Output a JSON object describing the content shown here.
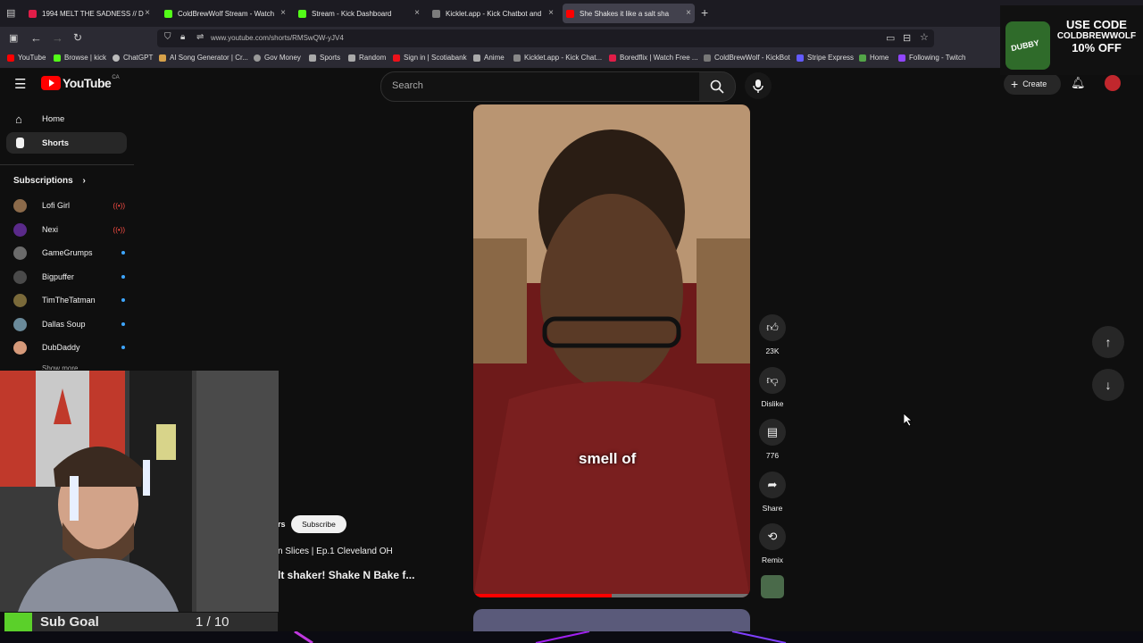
{
  "browser": {
    "tabs": [
      {
        "label": "1994 MELT THE SADNESS // D",
        "color": "#e11d48"
      },
      {
        "label": "ColdBrewWolf Stream - Watch",
        "color": "#53fc18"
      },
      {
        "label": "Stream - Kick Dashboard",
        "color": "#53fc18"
      },
      {
        "label": "Kicklet.app - Kick Chatbot and",
        "color": "#7c7c7c"
      },
      {
        "label": "She Shakes it like a salt sha",
        "color": "#ff0000"
      }
    ],
    "url": "www.youtube.com/shorts/RMSwQW-yJV4",
    "bookmarks": [
      "YouTube",
      "Browse | kick",
      "ChatGPT",
      "AI Song Generator | Cr...",
      "Gov Money",
      "Sports",
      "Random",
      "Sign in | Scotiabank",
      "Anime",
      "Kicklet.app - Kick Chat...",
      "Boredflix | Watch Free ...",
      "ColdBrewWolf - KickBot",
      "Stripe Express",
      "Home",
      "Following - Twitch"
    ]
  },
  "youtube": {
    "logo": "YouTube",
    "region": "CA",
    "search_placeholder": "Search",
    "create_label": "Create",
    "nav": [
      {
        "label": "Home",
        "icon": "home-icon"
      },
      {
        "label": "Shorts",
        "icon": "shorts-icon"
      }
    ],
    "subscriptions_title": "Subscriptions",
    "subscriptions": [
      {
        "name": "Lofi Girl",
        "color": "#8b6a4a",
        "live": true
      },
      {
        "name": "Nexi",
        "color": "#5a2a8a",
        "live": true
      },
      {
        "name": "GameGrumps",
        "color": "#6b6b6b",
        "live": false
      },
      {
        "name": "Bigpuffer",
        "color": "#4a4a4a",
        "live": false
      },
      {
        "name": "TimTheTatman",
        "color": "#7a6a3a",
        "live": false
      },
      {
        "name": "Dallas Soup",
        "color": "#6a8a9a",
        "live": false
      },
      {
        "name": "DubDaddy",
        "color": "#d69a7a",
        "live": false
      }
    ],
    "show_more": "Show more",
    "short": {
      "caption": "smell of",
      "channel_suffix": "rs",
      "subscribe": "Subscribe",
      "series": "n Slices | Ep.1 Cleveland OH",
      "title": "lt shaker! Shake N Bake f...",
      "progress_pct": 50
    },
    "actions": {
      "likes": "23K",
      "dislike": "Dislike",
      "comments": "776",
      "share": "Share",
      "remix": "Remix"
    }
  },
  "overlay": {
    "ad_line1": "USE CODE",
    "ad_line2": "COLDBREWWOLF",
    "ad_line3": "10% OFF",
    "ad_brand": "DUBBY",
    "sub_goal_label": "Sub Goal",
    "sub_goal_value": "1 / 10"
  }
}
